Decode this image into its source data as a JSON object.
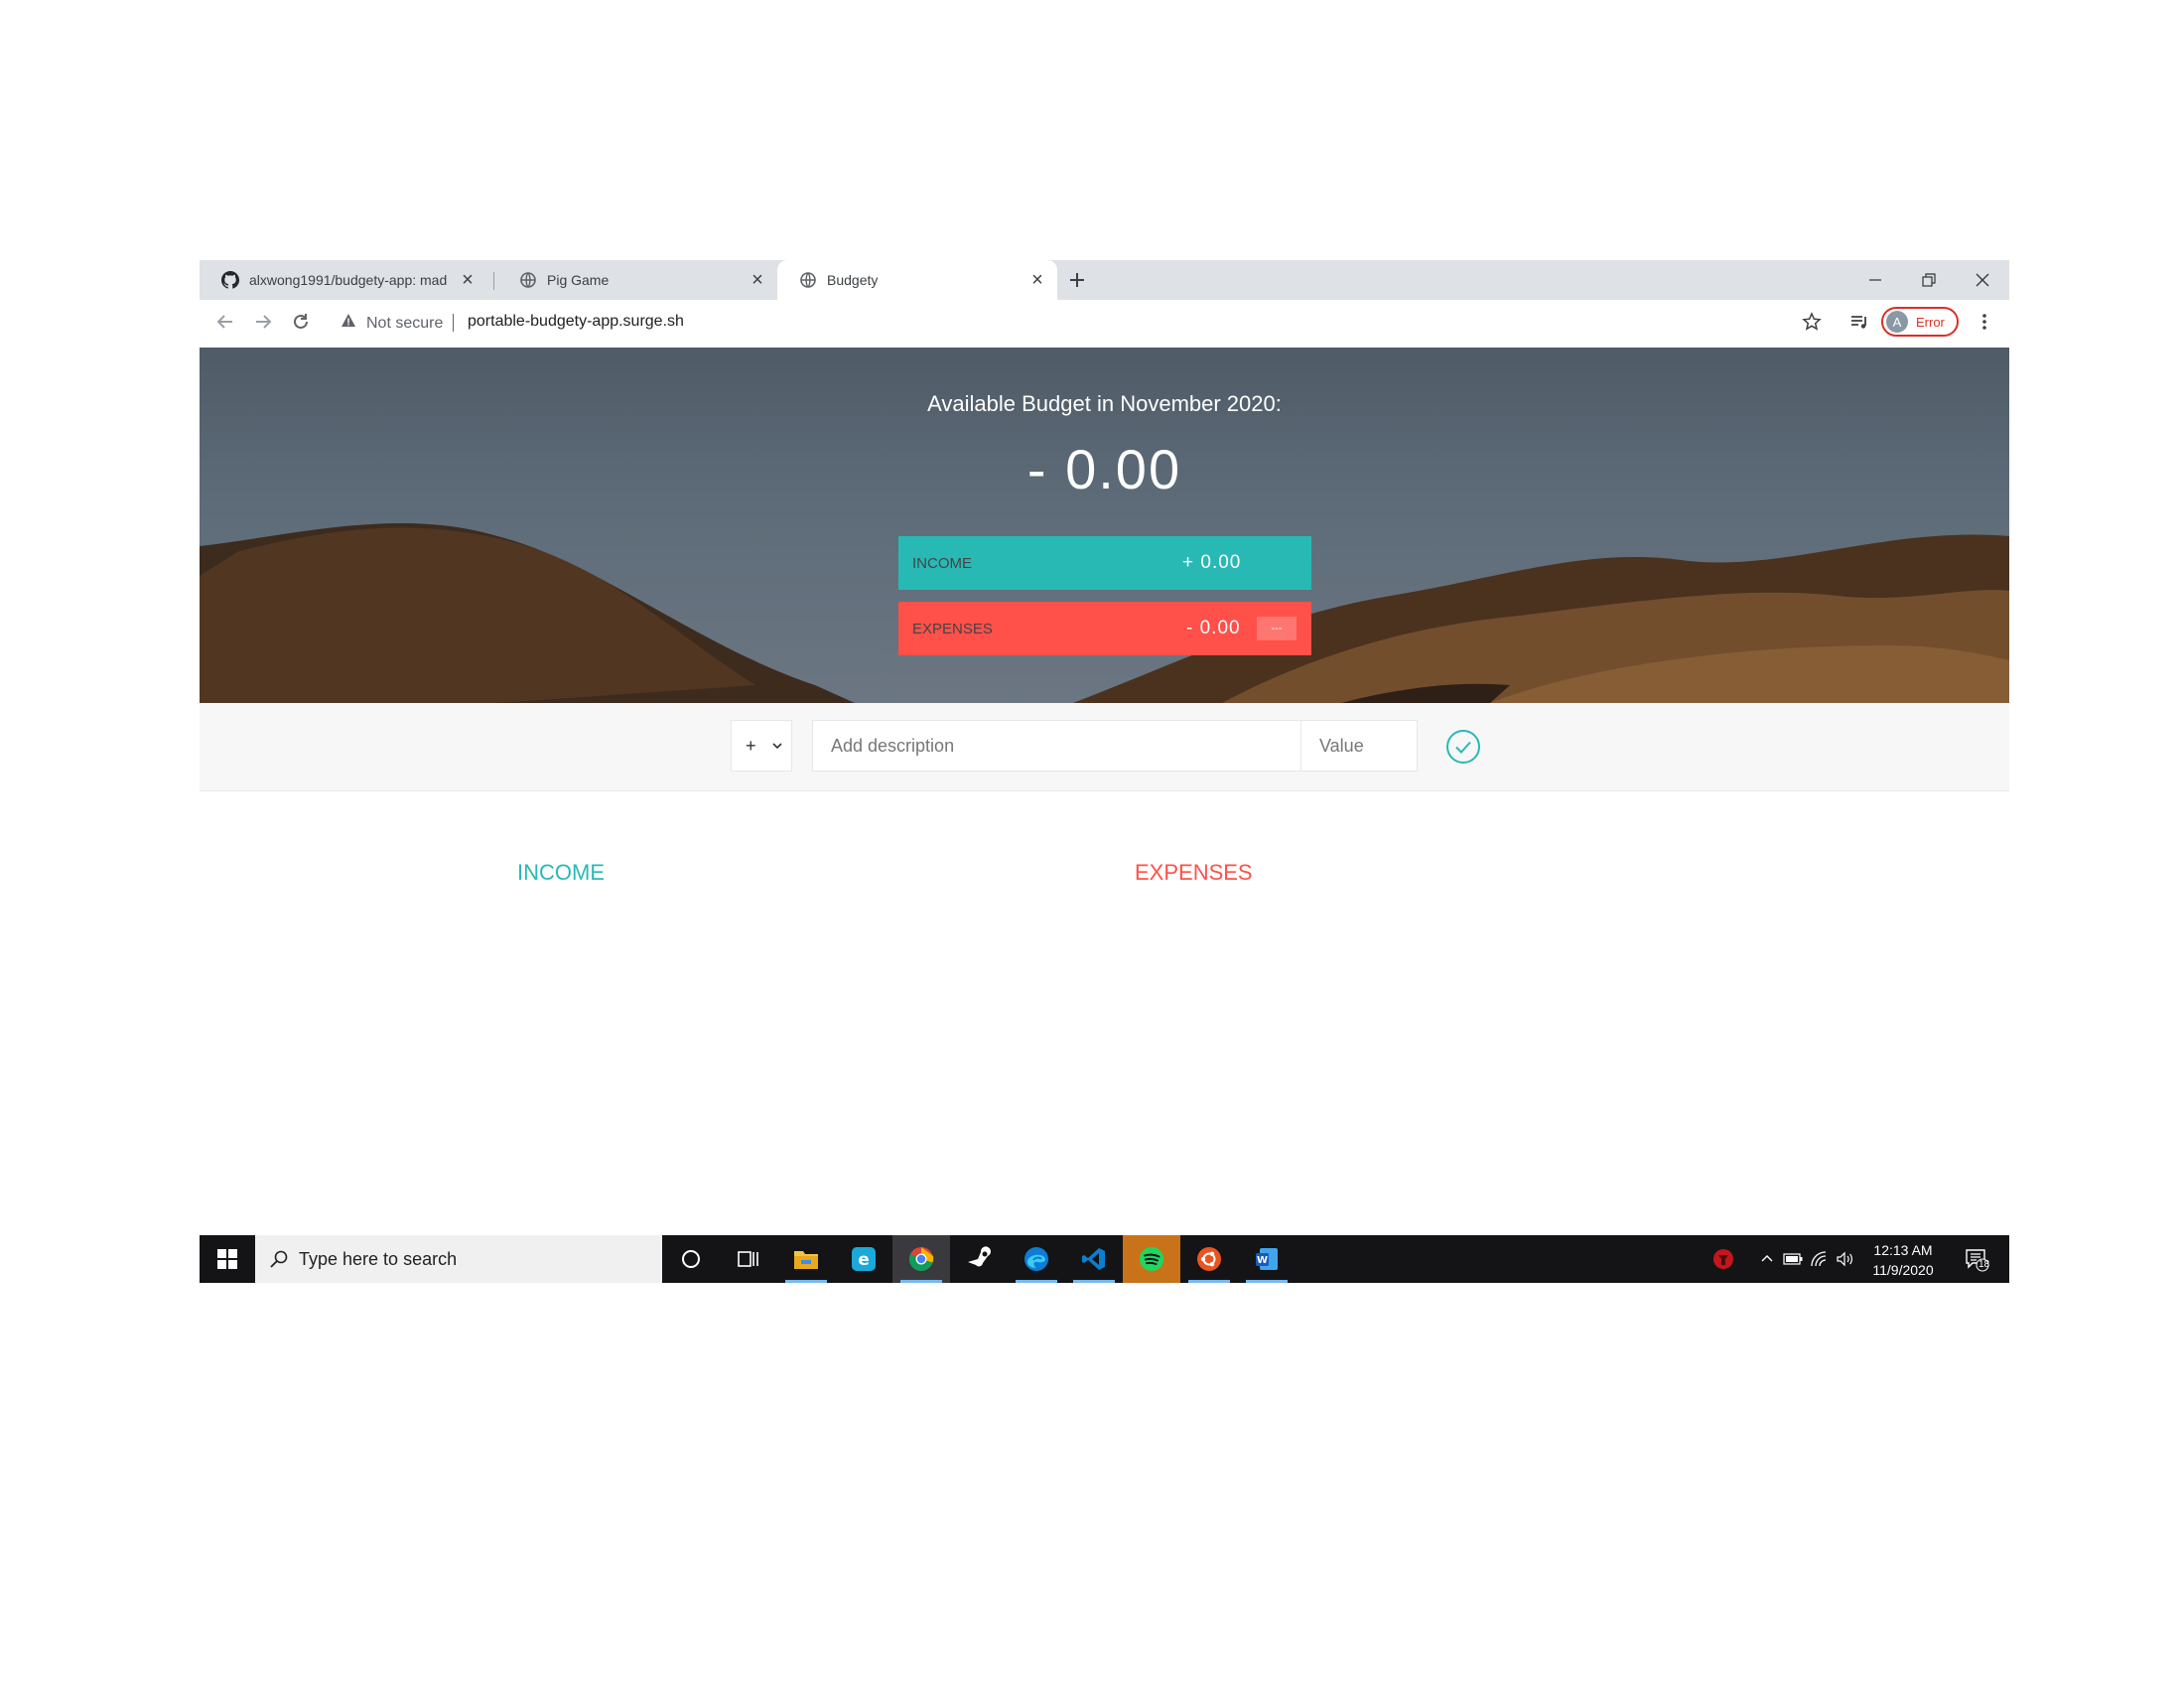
{
  "browser": {
    "tabs": [
      {
        "title": "alxwong1991/budgety-app: mad",
        "icon": "github-icon"
      },
      {
        "title": "Pig Game",
        "icon": "globe-icon"
      },
      {
        "title": "Budgety",
        "icon": "globe-icon",
        "active": true
      }
    ],
    "security_label": "Not secure",
    "url": "portable-budgety-app.surge.sh",
    "profile_initial": "A",
    "profile_status": "Error"
  },
  "app": {
    "budget_title": "Available Budget in November 2020:",
    "budget_value": "- 0.00",
    "income_label": "INCOME",
    "income_value": "+ 0.00",
    "expenses_label": "EXPENSES",
    "expenses_value": "- 0.00",
    "expenses_percentage": "---",
    "type_selected": "+",
    "description_placeholder": "Add description",
    "value_placeholder": "Value",
    "income_header": "INCOME",
    "expenses_header": "EXPENSES",
    "colors": {
      "income": "#28b9b5",
      "expenses": "#ff5049"
    }
  },
  "taskbar": {
    "search_placeholder": "Type here to search",
    "apps": [
      "file-explorer-icon",
      "edge-legacy-icon",
      "chrome-icon",
      "steam-icon",
      "edge-icon",
      "vscode-icon",
      "spotify-icon",
      "ubuntu-icon",
      "word-icon"
    ],
    "time": "12:13 AM",
    "date": "11/9/2020",
    "notification_count": "18"
  }
}
